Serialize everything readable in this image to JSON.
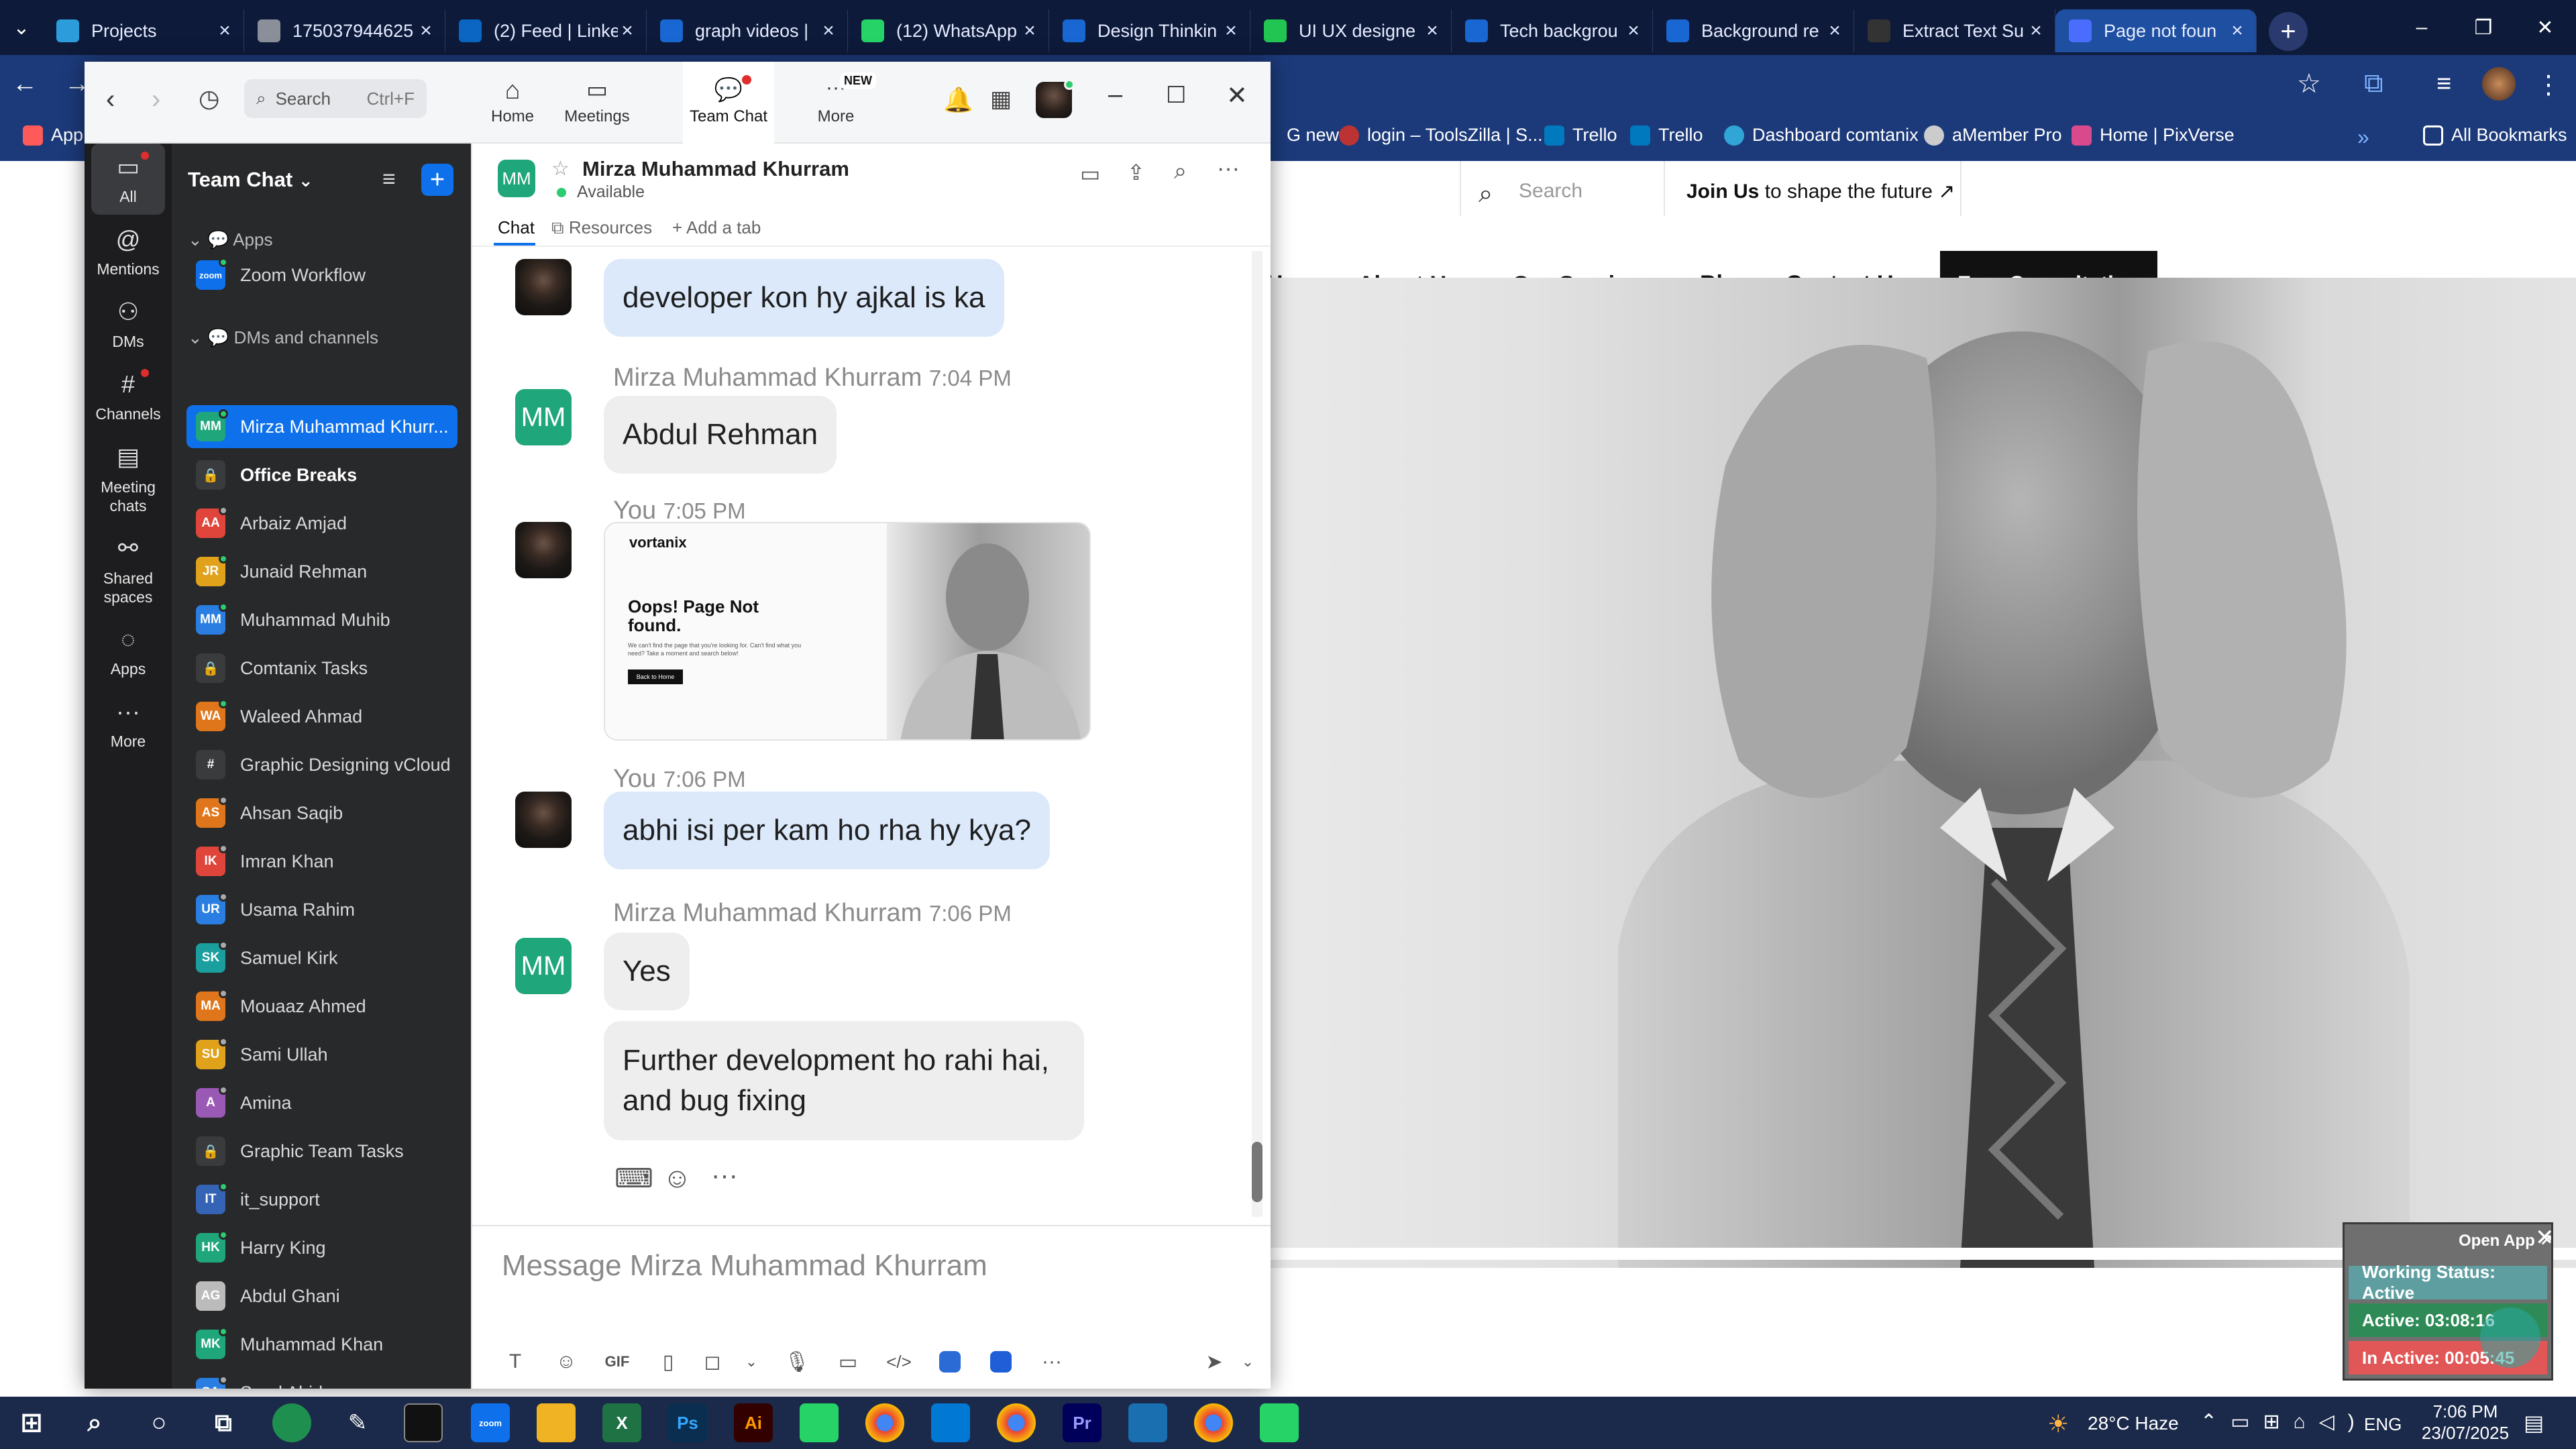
{
  "browser": {
    "tabs": [
      {
        "title": "Projects",
        "color": "#2d9cdb"
      },
      {
        "title": "175037944625",
        "color": "#8a8f99"
      },
      {
        "title": "(2) Feed | Linke",
        "color": "#0a66c2"
      },
      {
        "title": "graph videos |",
        "color": "#1967d2"
      },
      {
        "title": "(12) WhatsApp",
        "color": "#25d366"
      },
      {
        "title": "Design Thinkin",
        "color": "#1967d2"
      },
      {
        "title": "UI UX designe",
        "color": "#23c552"
      },
      {
        "title": "Tech backgrou",
        "color": "#1967d2"
      },
      {
        "title": "Background re",
        "color": "#1967d2"
      },
      {
        "title": "Extract Text Su",
        "color": "#333333"
      },
      {
        "title": "Page not foun",
        "color": "#4a6cff"
      }
    ],
    "new_tab": "+",
    "bookmarks": [
      {
        "label": "App",
        "color": "#ff5a5a"
      },
      {
        "label": "G new",
        "color": "#ffffff"
      },
      {
        "label": "login – ToolsZilla | S...",
        "color": "#b33"
      },
      {
        "label": "Trello",
        "color": "#0079bf"
      },
      {
        "label": "Trello",
        "color": "#0079bf"
      },
      {
        "label": "Dashboard comtanix",
        "color": "#31a6d6"
      },
      {
        "label": "aMember Pro",
        "color": "#cccccc"
      },
      {
        "label": "Home | PixVerse",
        "color": "#d94a8c"
      },
      {
        "label": "»",
        "color": ""
      },
      {
        "label": "All Bookmarks",
        "color": "#ffffff"
      }
    ]
  },
  "website": {
    "search_placeholder": "Search",
    "join_bold": "Join Us",
    "join_rest": " to shape the future",
    "nav": [
      "Home",
      "About Us",
      "Our Services",
      "Blog",
      "Contact Us"
    ],
    "cta": "Free Consultation"
  },
  "zoom": {
    "search_placeholder": "Search",
    "search_shortcut": "Ctrl+F",
    "top_tabs": [
      {
        "label": "Home"
      },
      {
        "label": "Meetings"
      },
      {
        "label": "Team Chat"
      },
      {
        "label": "More",
        "badge": "NEW"
      }
    ],
    "rail": [
      {
        "label": "All"
      },
      {
        "label": "Mentions"
      },
      {
        "label": "DMs"
      },
      {
        "label": "Channels"
      },
      {
        "label": "Meeting chats"
      },
      {
        "label": "Shared spaces"
      },
      {
        "label": "Apps"
      },
      {
        "label": "More"
      }
    ],
    "list_title": "Team Chat",
    "sections": {
      "apps": "Apps",
      "dms": "DMs and channels"
    },
    "apps_item": "Zoom Workflow",
    "contacts": [
      {
        "initials": "MM",
        "name": "Mirza Muhammad Khurr...",
        "color": "#1fa67a",
        "status": "#2ecc71",
        "selected": true
      },
      {
        "initials": "",
        "name": "Office Breaks",
        "color": "#3a3b3d",
        "status": "",
        "bold": true
      },
      {
        "initials": "AA",
        "name": "Arbaiz Amjad",
        "color": "#e0453b",
        "status": "#aaaaaa"
      },
      {
        "initials": "JR",
        "name": "Junaid Rehman",
        "color": "#e0a21b",
        "status": "#2ecc71"
      },
      {
        "initials": "MM",
        "name": "Muhammad Muhib",
        "color": "#2a7de1",
        "status": "#2ecc71"
      },
      {
        "initials": "",
        "name": "Comtanix Tasks",
        "color": "#3a3b3d",
        "status": ""
      },
      {
        "initials": "WA",
        "name": "Waleed Ahmad",
        "color": "#e0761b",
        "status": "#2ecc71"
      },
      {
        "initials": "#",
        "name": "Graphic Designing vCloud",
        "color": "#3a3b3d",
        "status": ""
      },
      {
        "initials": "AS",
        "name": "Ahsan Saqib",
        "color": "#e0761b",
        "status": "#aaaaaa"
      },
      {
        "initials": "IK",
        "name": "Imran Khan",
        "color": "#e0453b",
        "status": "#aaaaaa"
      },
      {
        "initials": "UR",
        "name": "Usama Rahim",
        "color": "#2a7de1",
        "status": "#aaaaaa"
      },
      {
        "initials": "SK",
        "name": "Samuel Kirk",
        "color": "#1a9e9e",
        "status": "#aaaaaa"
      },
      {
        "initials": "MA",
        "name": "Mouaaz Ahmed",
        "color": "#e0761b",
        "status": "#aaaaaa"
      },
      {
        "initials": "SU",
        "name": "Sami Ullah",
        "color": "#e0a21b",
        "status": "#aaaaaa"
      },
      {
        "initials": "A",
        "name": "Amina",
        "color": "#9b59b6",
        "status": "#aaaaaa"
      },
      {
        "initials": "",
        "name": "Graphic Team Tasks",
        "color": "#3a3b3d",
        "status": ""
      },
      {
        "initials": "IT",
        "name": "it_support",
        "color": "#3563b5",
        "status": "#2ecc71"
      },
      {
        "initials": "HK",
        "name": "Harry King",
        "color": "#1fa67a",
        "status": "#2ecc71"
      },
      {
        "initials": "AG",
        "name": "Abdul Ghani",
        "color": "#bbbbbb",
        "status": ""
      },
      {
        "initials": "MK",
        "name": "Muhammad Khan",
        "color": "#1fa67a",
        "status": "#2ecc71"
      },
      {
        "initials": "SA",
        "name": "Saad Abid",
        "color": "#2a7de1",
        "status": "#aaaaaa"
      }
    ],
    "chat": {
      "contact_initials": "MM",
      "contact_name": "Mirza Muhammad Khurram",
      "status": "Available",
      "tabs": [
        "Chat",
        "Resources",
        "Add a tab"
      ],
      "messages": [
        {
          "from": "You",
          "time": "",
          "text": "developer kon hy ajkal is ka"
        },
        {
          "from": "Mirza Muhammad Khurram",
          "time": "7:04 PM",
          "text": "Abdul Rehman"
        },
        {
          "from": "You",
          "time": "7:05 PM",
          "image": {
            "logo": "vortanix",
            "headline": "Oops! Page Not found.",
            "body": "We can't find the page that you're looking for. Can't find what you need? Take a moment and search below!",
            "button": "Back to Home"
          }
        },
        {
          "from": "You",
          "time": "7:06 PM",
          "text": "abhi isi per kam ho rha hy kya?"
        },
        {
          "from": "Mirza Muhammad Khurram",
          "time": "7:06 PM",
          "text": "Yes"
        },
        {
          "from": "Mirza Muhammad Khurram",
          "time": "",
          "text": "Further development ho rahi hai, and bug fixing"
        }
      ],
      "composer_placeholder": "Message Mirza Muhammad Khurram"
    }
  },
  "widget": {
    "open_app": "Open App ↗",
    "working_status": "Working Status: Active",
    "active": "Active: 03:08:16",
    "inactive": "In Active: 00:05:45"
  },
  "taskbar": {
    "weather": "28°C Haze",
    "lang": "ENG",
    "time": "7:06 PM",
    "date": "23/07/2025"
  }
}
